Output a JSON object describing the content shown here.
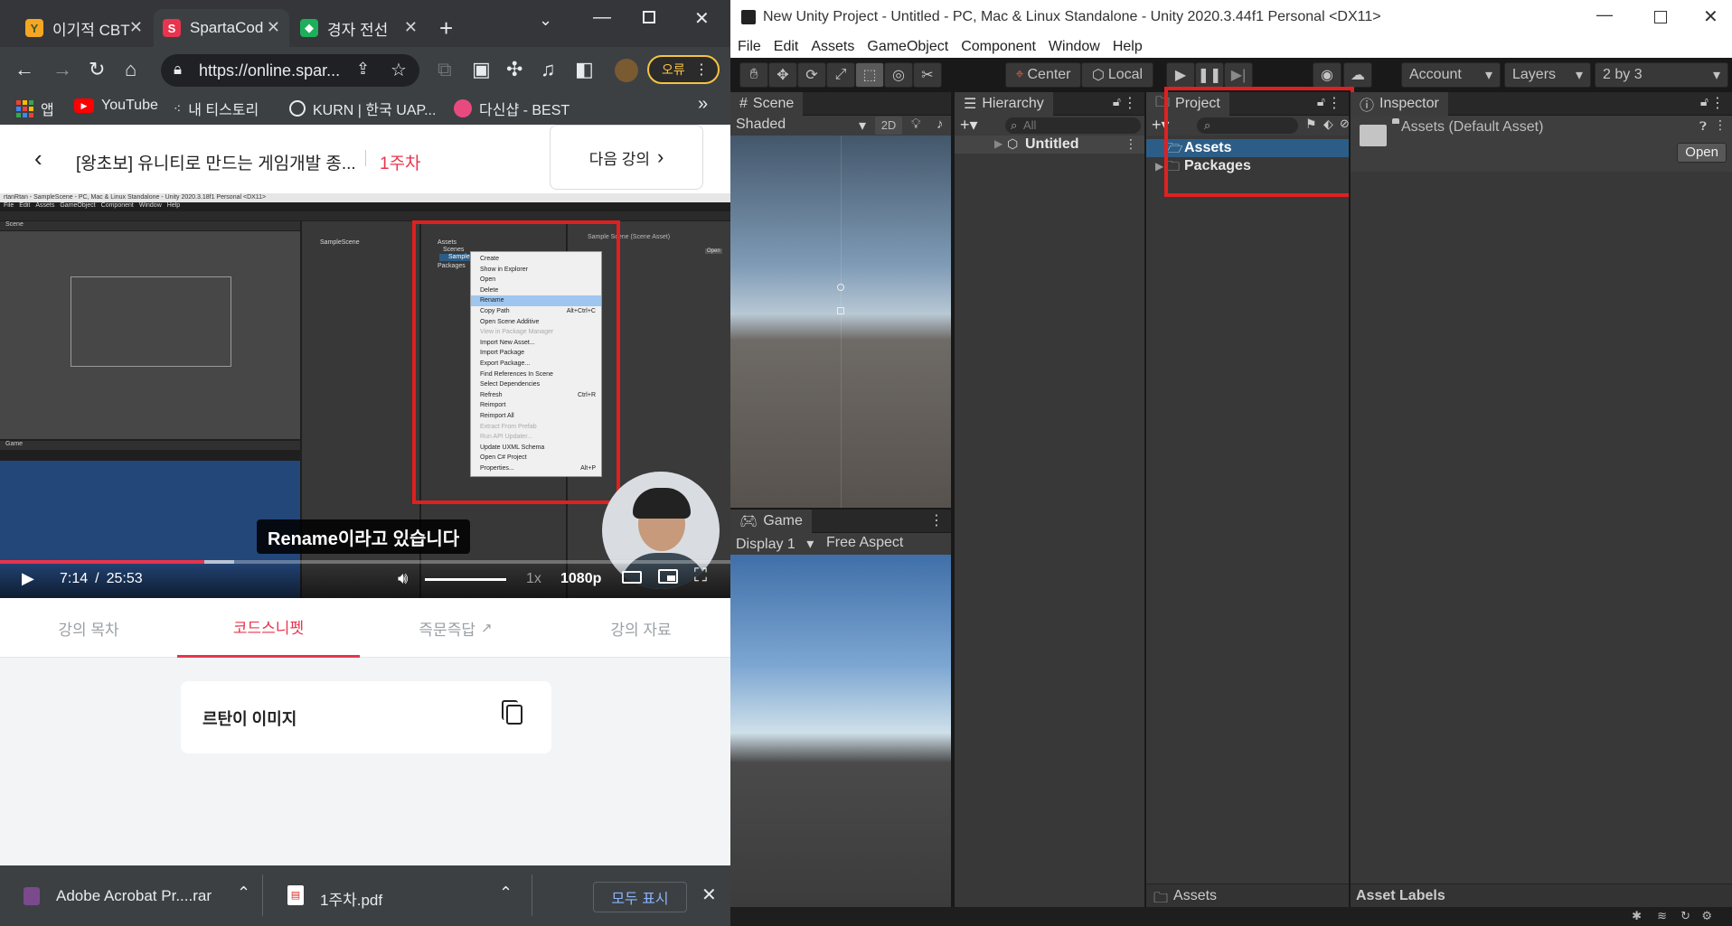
{
  "chrome": {
    "tabs": [
      {
        "label": "이기적 CBT",
        "active": false
      },
      {
        "label": "SpartaCod",
        "active": true
      },
      {
        "label": "경자 전선",
        "active": false
      }
    ],
    "url": "https://online.spar...",
    "error_badge": "오류",
    "bookmarks": [
      "앱",
      "YouTube",
      "내 티스토리",
      "KURN | 한국 UAP...",
      "다신샵 - BEST"
    ],
    "bookmarks_overflow": "»"
  },
  "course": {
    "title": "[왕초보] 유니티로 만드는 게임개발 종...",
    "week": "1주차",
    "next_button": "다음 강의",
    "subtitle": "Rename이라고 있습니다",
    "time_current": "7:14",
    "time_sep": "/",
    "time_total": "25:53",
    "progress_fraction": 0.28,
    "buffered_fraction": 0.32,
    "volume_fraction": 1.0,
    "speed": "1x",
    "quality": "1080p",
    "tabs": [
      "강의 목차",
      "코드스니펫",
      "즉문즉답",
      "강의 자료"
    ],
    "active_tab": 1,
    "snippet_title": "르탄이 이미지"
  },
  "video_frame": {
    "window_title": "rtanRtan - SampleScene - PC, Mac & Linux Standalone - Unity 2020.3.18f1 Personal <DX11>",
    "menu": [
      "File",
      "Edit",
      "Assets",
      "GameObject",
      "Component",
      "Window",
      "Help"
    ],
    "context_menu": [
      {
        "label": "Create",
        "shortcut": "",
        "disabled": false,
        "highlight": false
      },
      {
        "label": "Show in Explorer",
        "shortcut": "",
        "disabled": false,
        "highlight": false
      },
      {
        "label": "Open",
        "shortcut": "",
        "disabled": false,
        "highlight": false
      },
      {
        "label": "Delete",
        "shortcut": "",
        "disabled": false,
        "highlight": false
      },
      {
        "label": "Rename",
        "shortcut": "",
        "disabled": false,
        "highlight": true
      },
      {
        "label": "Copy Path",
        "shortcut": "Alt+Ctrl+C",
        "disabled": false,
        "highlight": false
      },
      {
        "label": "Open Scene Additive",
        "shortcut": "",
        "disabled": false,
        "highlight": false
      },
      {
        "label": "View in Package Manager",
        "shortcut": "",
        "disabled": true,
        "highlight": false
      },
      {
        "label": "Import New Asset...",
        "shortcut": "",
        "disabled": false,
        "highlight": false
      },
      {
        "label": "Import Package",
        "shortcut": "",
        "disabled": false,
        "highlight": false
      },
      {
        "label": "Export Package...",
        "shortcut": "",
        "disabled": false,
        "highlight": false
      },
      {
        "label": "Find References In Scene",
        "shortcut": "",
        "disabled": false,
        "highlight": false
      },
      {
        "label": "Select Dependencies",
        "shortcut": "",
        "disabled": false,
        "highlight": false
      },
      {
        "label": "Refresh",
        "shortcut": "Ctrl+R",
        "disabled": false,
        "highlight": false
      },
      {
        "label": "Reimport",
        "shortcut": "",
        "disabled": false,
        "highlight": false
      },
      {
        "label": "Reimport All",
        "shortcut": "",
        "disabled": false,
        "highlight": false
      },
      {
        "label": "Extract From Prefab",
        "shortcut": "",
        "disabled": true,
        "highlight": false
      },
      {
        "label": "Run API Updater...",
        "shortcut": "",
        "disabled": true,
        "highlight": false
      },
      {
        "label": "Update UXML Schema",
        "shortcut": "",
        "disabled": false,
        "highlight": false
      },
      {
        "label": "Open C# Project",
        "shortcut": "",
        "disabled": false,
        "highlight": false
      },
      {
        "label": "Properties...",
        "shortcut": "Alt+P",
        "disabled": false,
        "highlight": false
      }
    ],
    "project_items": [
      "Assets",
      "Scenes",
      "SampleScene",
      "Packages"
    ],
    "hierarchy_item": "SampleScene",
    "inspector_title": "Sample Scene (Scene Asset)",
    "open_btn": "Open"
  },
  "downloads": {
    "items": [
      "Adobe Acrobat Pr....rar",
      "1주차.pdf"
    ],
    "show_all": "모두 표시"
  },
  "unity": {
    "title": "New Unity Project - Untitled - PC, Mac & Linux Standalone - Unity 2020.3.44f1 Personal <DX11>",
    "menu": [
      "File",
      "Edit",
      "Assets",
      "GameObject",
      "Component",
      "Window",
      "Help"
    ],
    "toolbar": {
      "center": "Center",
      "local": "Local",
      "account": "Account",
      "layers": "Layers",
      "layout": "2 by 3"
    },
    "scene_tab": "Scene",
    "shaded": "Shaded",
    "mode_2d": "2D",
    "game_tab": "Game",
    "display": "Display 1",
    "aspect": "Free Aspect",
    "hierarchy_tab": "Hierarchy",
    "hierarchy_search": "All",
    "hierarchy_scene": "Untitled",
    "project_tab": "Project",
    "project_items": [
      "Assets",
      "Packages"
    ],
    "project_hidden_count": "1",
    "project_footer": "Assets",
    "inspector_tab": "Inspector",
    "inspector_title": "Assets (Default Asset)",
    "inspector_open": "Open",
    "asset_labels": "Asset Labels"
  }
}
